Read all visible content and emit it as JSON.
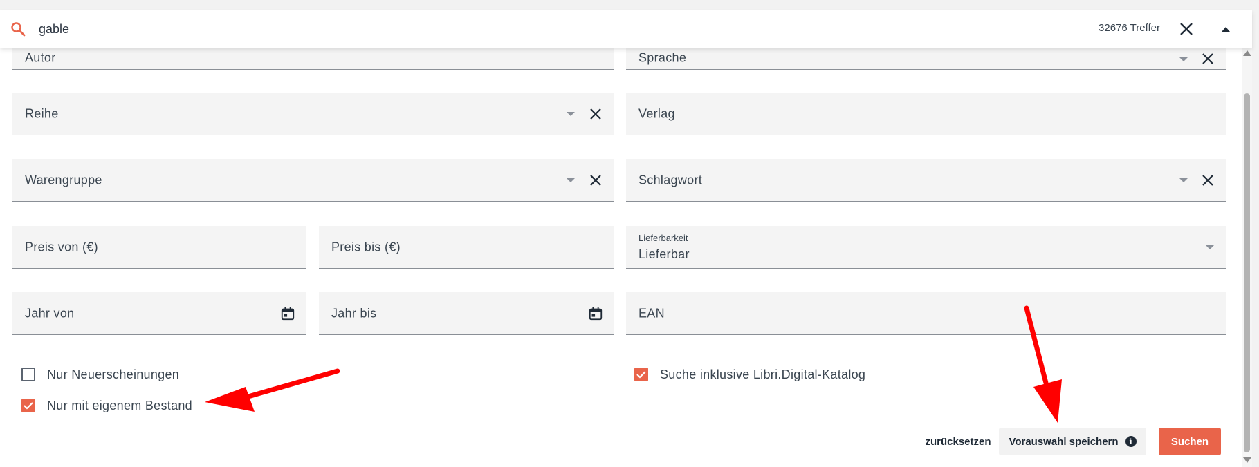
{
  "search": {
    "value": "gable",
    "hits": "32676 Treffer"
  },
  "filters": {
    "autor": "Autor",
    "sprache": "Sprache",
    "reihe": "Reihe",
    "verlag": "Verlag",
    "warengruppe": "Warengruppe",
    "schlagwort": "Schlagwort",
    "preis_von": "Preis von (€)",
    "preis_bis": "Preis bis (€)",
    "lieferbarkeit_label": "Lieferbarkeit",
    "lieferbarkeit_value": "Lieferbar",
    "jahr_von": "Jahr von",
    "jahr_bis": "Jahr bis",
    "ean": "EAN"
  },
  "checkboxes": {
    "neuerscheinungen": {
      "label": "Nur Neuerscheinungen",
      "checked": false
    },
    "eigener_bestand": {
      "label": "Nur mit eigenem Bestand",
      "checked": true
    },
    "libri_digital": {
      "label": "Suche inklusive Libri.Digital-Katalog",
      "checked": true
    }
  },
  "actions": {
    "reset": "zurücksetzen",
    "save": "Vorauswahl speichern",
    "search": "Suchen"
  },
  "colors": {
    "accent": "#e9644a",
    "annotation": "#ff0000"
  }
}
